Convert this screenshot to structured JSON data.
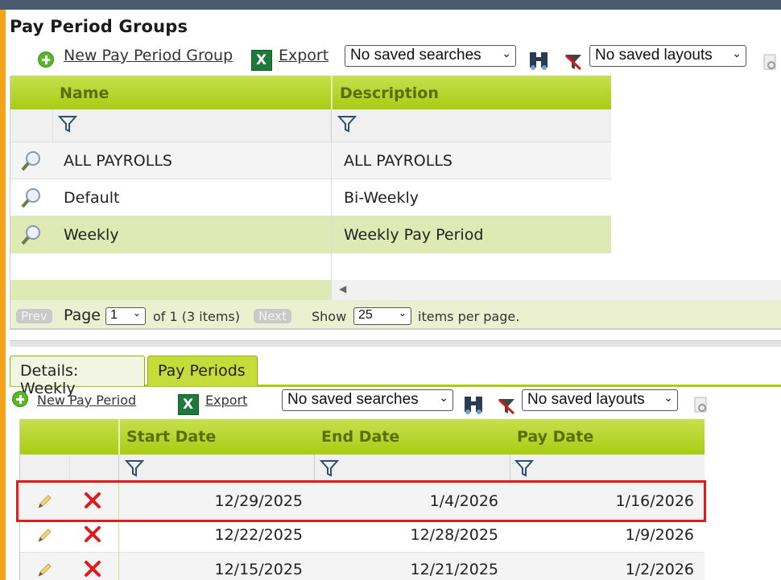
{
  "page": {
    "title": "Pay Period Groups"
  },
  "toolbar1": {
    "new_label": "New Pay Period Group",
    "export_label": "Export",
    "saved_searches": "No saved searches",
    "saved_layouts": "No saved layouts"
  },
  "grid1": {
    "columns": [
      "Name",
      "Description"
    ],
    "rows": [
      {
        "name": "ALL PAYROLLS",
        "description": "ALL PAYROLLS"
      },
      {
        "name": "Default",
        "description": "Bi-Weekly"
      },
      {
        "name": "Weekly",
        "description": "Weekly Pay Period"
      }
    ],
    "pager": {
      "prev": "Prev",
      "page_label": "Page",
      "page_value": "1",
      "of_text": "of 1 (3 items)",
      "next": "Next",
      "show_label": "Show",
      "per_page": "25",
      "per_page_suffix": "items per page."
    }
  },
  "tabs": [
    "Details: Weekly",
    "Pay Periods"
  ],
  "toolbar2": {
    "new_label": "New Pay Period",
    "export_label": "Export",
    "saved_searches": "No saved searches",
    "saved_layouts": "No saved layouts"
  },
  "grid2": {
    "columns": [
      "Start Date",
      "End Date",
      "Pay Date"
    ],
    "rows": [
      {
        "start": "12/29/2025",
        "end": "1/4/2026",
        "pay": "1/16/2026"
      },
      {
        "start": "12/22/2025",
        "end": "12/28/2025",
        "pay": "1/9/2026"
      },
      {
        "start": "12/15/2025",
        "end": "12/21/2025",
        "pay": "1/2/2026"
      }
    ]
  },
  "colors": {
    "accent": "#a9cc12",
    "highlight_border": "#e01b1b",
    "selected_row": "#dfe9b3"
  }
}
